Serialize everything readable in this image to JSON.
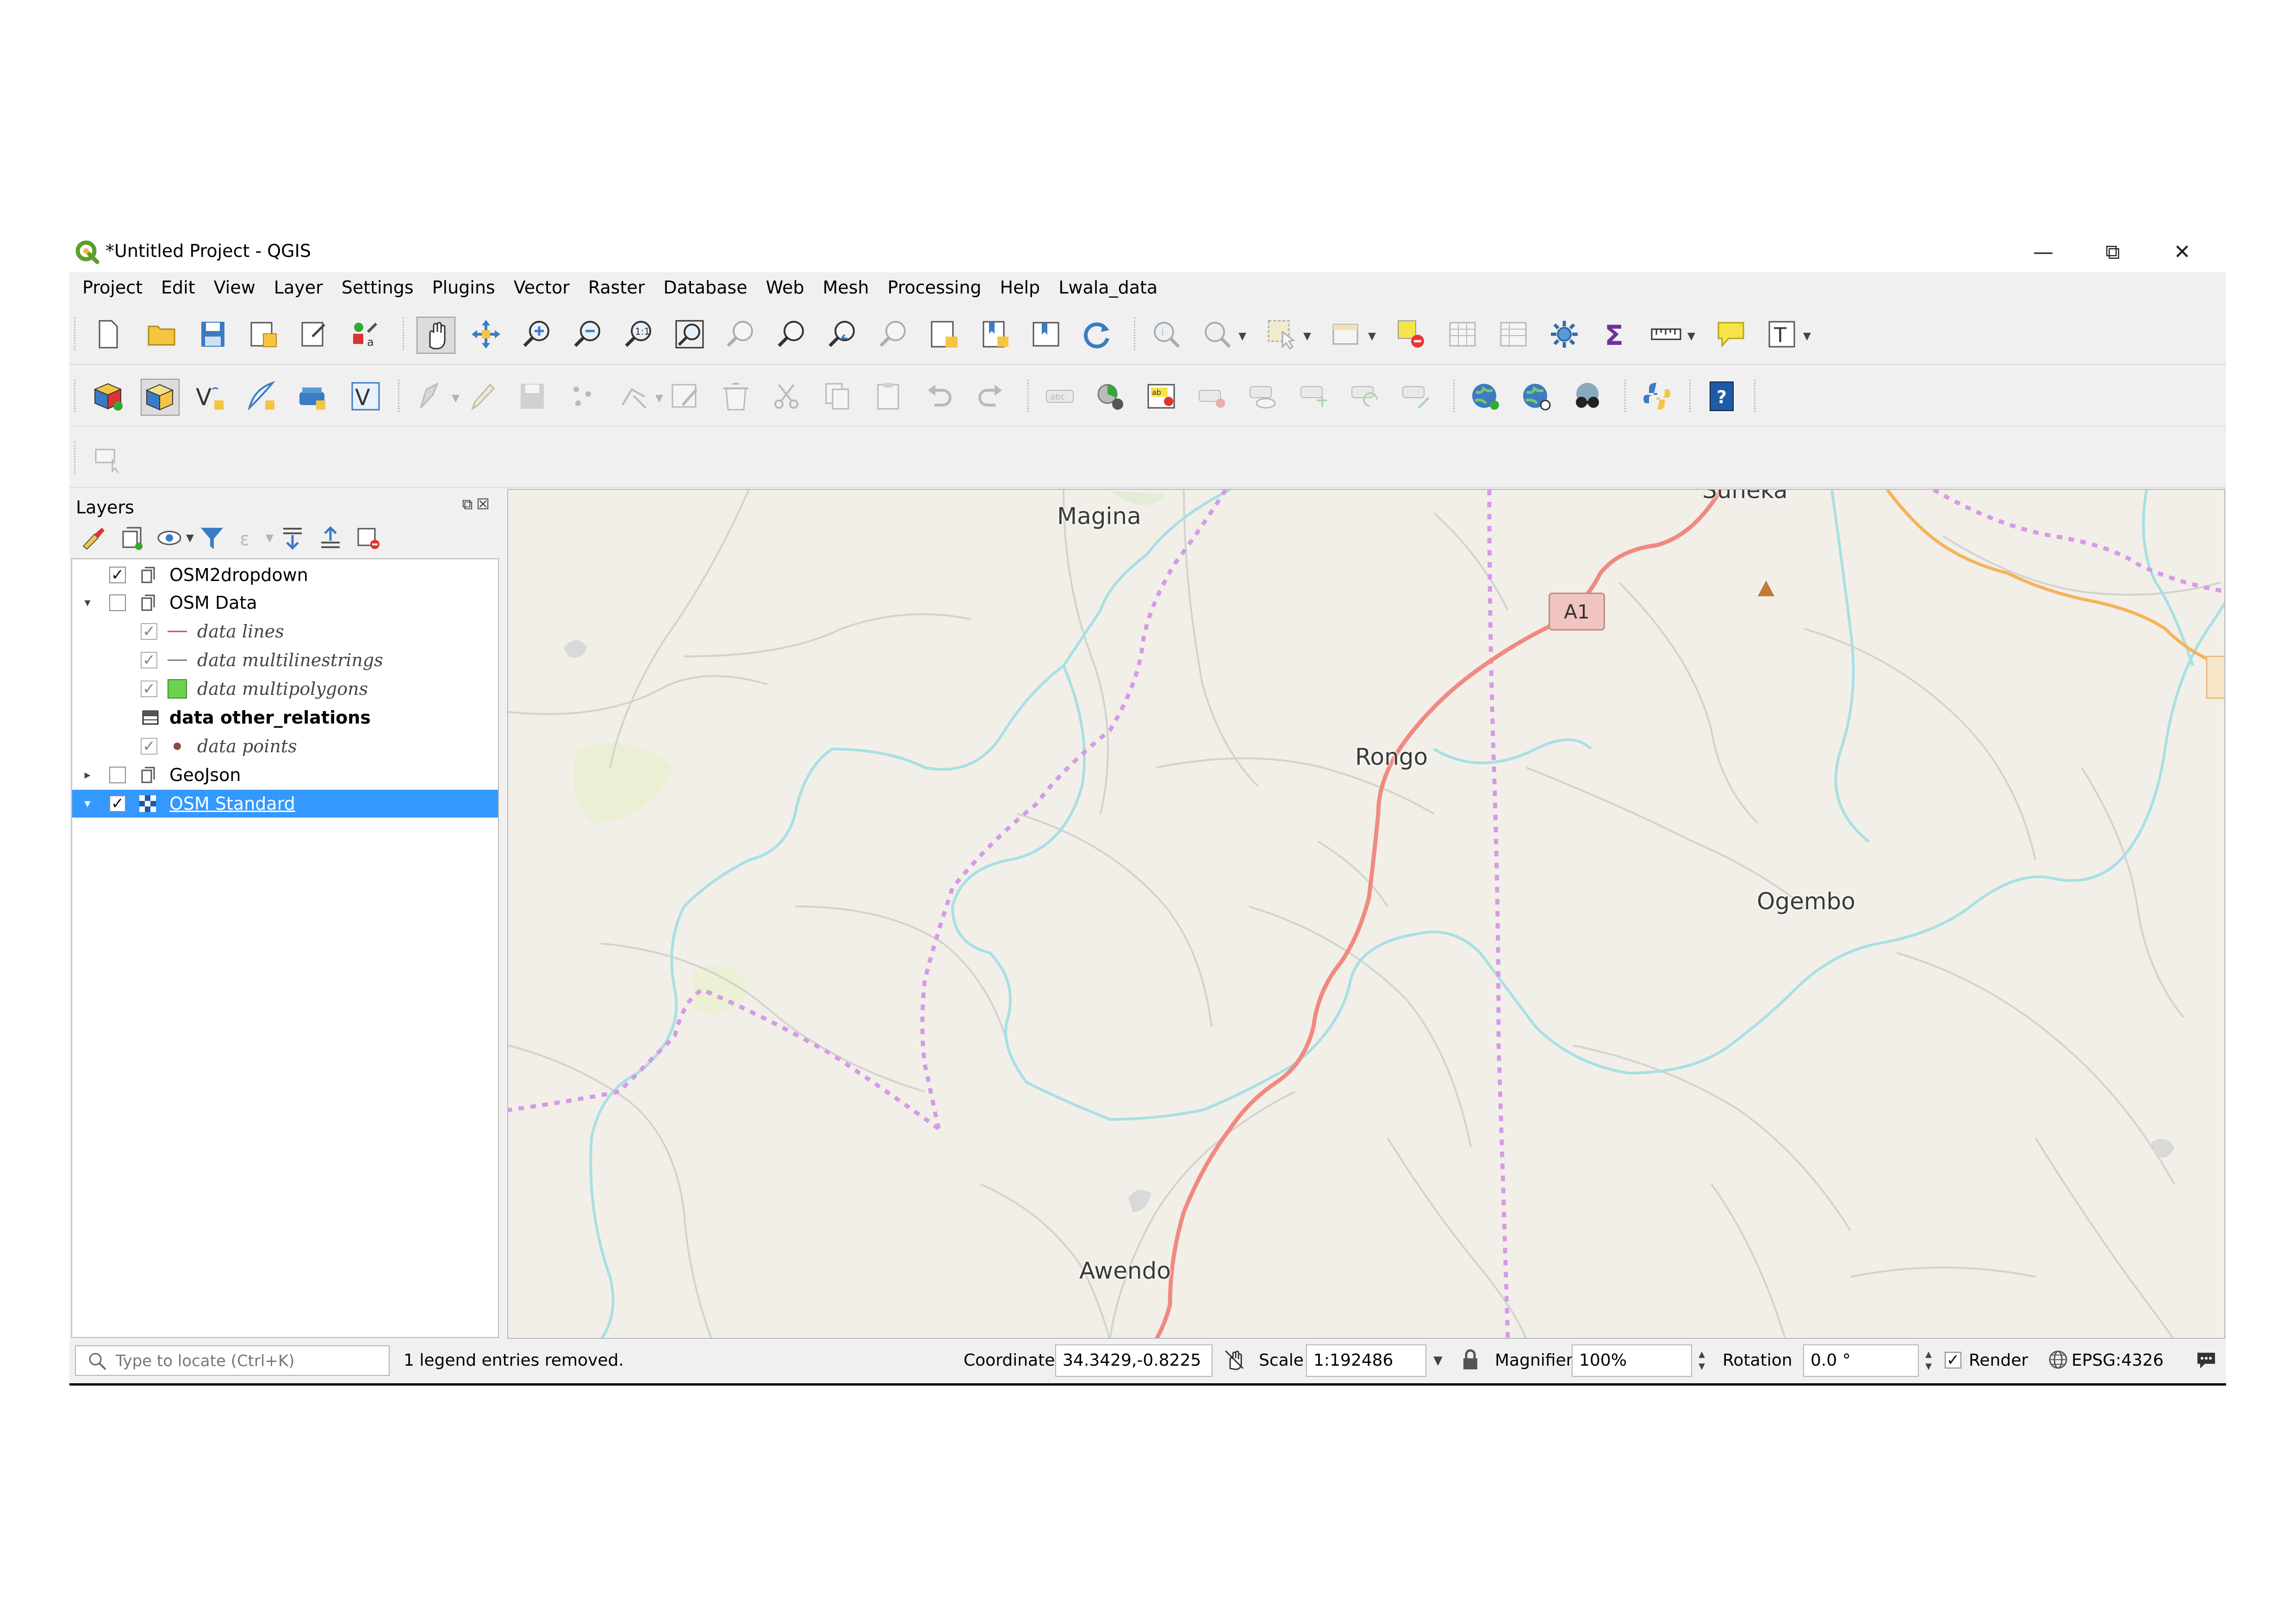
{
  "window": {
    "title": "*Untitled Project - QGIS",
    "controls": [
      "minimize",
      "restore",
      "close"
    ]
  },
  "menu": [
    "Project",
    "Edit",
    "View",
    "Layer",
    "Settings",
    "Plugins",
    "Vector",
    "Raster",
    "Database",
    "Web",
    "Mesh",
    "Processing",
    "Help",
    "Lwala_data"
  ],
  "layers_panel": {
    "title": "Layers",
    "layers": [
      {
        "name": "OSM2dropdown",
        "checked": true,
        "expander": "",
        "style": "normal"
      },
      {
        "name": "OSM Data",
        "checked": false,
        "expander": "open",
        "style": "normal"
      },
      {
        "name": "data lines",
        "checked": true,
        "expander": "",
        "style": "italic"
      },
      {
        "name": "data multilinestrings",
        "checked": true,
        "expander": "",
        "style": "italic"
      },
      {
        "name": "data multipolygons",
        "checked": true,
        "expander": "",
        "style": "italic"
      },
      {
        "name": "data other_relations",
        "checked": null,
        "expander": "",
        "style": "bold"
      },
      {
        "name": "data points",
        "checked": true,
        "expander": "",
        "style": "italic"
      },
      {
        "name": "GeoJson",
        "checked": false,
        "expander": "closed",
        "style": "normal"
      },
      {
        "name": "OSM Standard",
        "checked": true,
        "expander": "open",
        "style": "selected"
      }
    ]
  },
  "map": {
    "places": [
      "Magina",
      "Suneka",
      "Rongo",
      "Ogembo",
      "Awendo"
    ],
    "road_shield": "A1",
    "colors": {
      "background": "#f2efe9",
      "road": "#f08a80",
      "river": "#a8e0e4",
      "boundary": "#d59be6",
      "minor_road": "#cfcfcf"
    }
  },
  "statusbar": {
    "locator_placeholder": "Type to locate (Ctrl+K)",
    "message": "1 legend entries removed.",
    "coordinate_label": "Coordinate",
    "coordinate": "34.3429,-0.8225",
    "scale_label": "Scale",
    "scale": "1:192486",
    "magnifier_label": "Magnifier",
    "magnifier": "100%",
    "rotation_label": "Rotation",
    "rotation": "0.0 °",
    "render_label": "Render",
    "render_checked": true,
    "crs": "EPSG:4326"
  }
}
